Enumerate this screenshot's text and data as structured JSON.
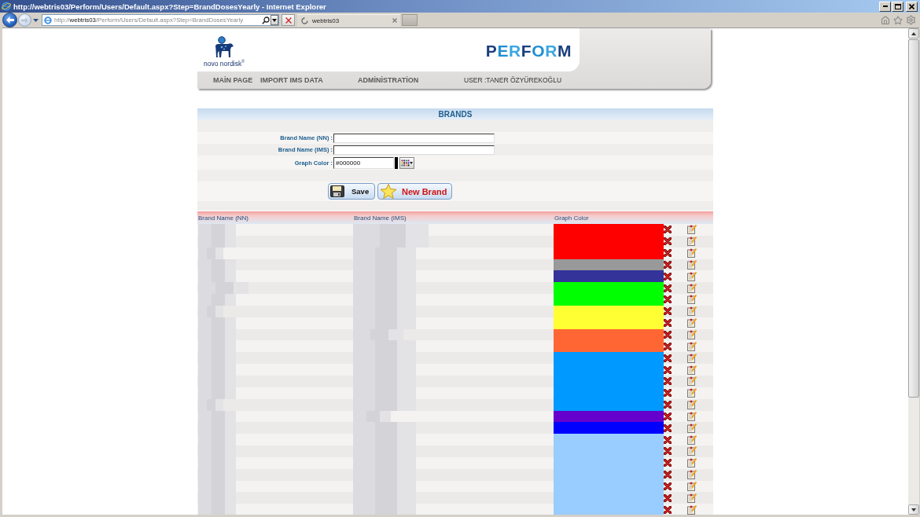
{
  "window": {
    "title": "http://webtris03/Perform/Users/Default.aspx?Step=BrandDosesYearly - Internet Explorer"
  },
  "browser": {
    "address": {
      "scheme": "http://",
      "host": "webtris03",
      "path": "/Perform/Users/Default.aspx?Step=BrandDosesYearly"
    },
    "tabs": [
      {
        "label": "webtris03",
        "selected": true
      }
    ]
  },
  "header": {
    "logo_text": "novo nordisk$^{®}$",
    "app_title": "PERFORM",
    "nav": [
      {
        "label": "MAİN PAGE"
      },
      {
        "label": "IMPORT IMS DATA"
      },
      {
        "label": "ADMİNİSTRATİON"
      }
    ],
    "user": "USER :TANER ÖZYÜREKOĞLU"
  },
  "section": {
    "title": "BRANDS"
  },
  "form": {
    "fields": [
      {
        "kind": "text",
        "label": "Brand Name (NN) :"
      },
      {
        "kind": "text",
        "label": "Brand Name (IMS) :"
      },
      {
        "kind": "color",
        "label": "Graph Color :",
        "value": "#000000",
        "color": "#000000"
      }
    ],
    "buttons": [
      {
        "kind": "save",
        "label": "Save"
      },
      {
        "kind": "new",
        "label": "New Brand"
      }
    ]
  },
  "table": {
    "columns": [
      "Brand Name (NN)",
      "Brand Name (IMS)",
      "Graph Color"
    ],
    "rows": [
      {
        "color": "#ff0000"
      },
      {
        "color": "#ff0000"
      },
      {
        "color": "#ff0000"
      },
      {
        "color": "#999999"
      },
      {
        "color": "#333399"
      },
      {
        "color": "#00ff00"
      },
      {
        "color": "#00ff00"
      },
      {
        "color": "#ffff33"
      },
      {
        "color": "#ffff33"
      },
      {
        "color": "#ff6633"
      },
      {
        "color": "#ff6633"
      },
      {
        "color": "#0099ff"
      },
      {
        "color": "#0099ff"
      },
      {
        "color": "#0099ff"
      },
      {
        "color": "#0099ff"
      },
      {
        "color": "#0099ff"
      },
      {
        "color": "#6600cc"
      },
      {
        "color": "#0000ff"
      },
      {
        "color": "#99ccff"
      },
      {
        "color": "#99ccff"
      },
      {
        "color": "#99ccff"
      },
      {
        "color": "#99ccff"
      },
      {
        "color": "#99ccff"
      },
      {
        "color": "#99ccff"
      },
      {
        "color": "#99ccff"
      }
    ]
  }
}
